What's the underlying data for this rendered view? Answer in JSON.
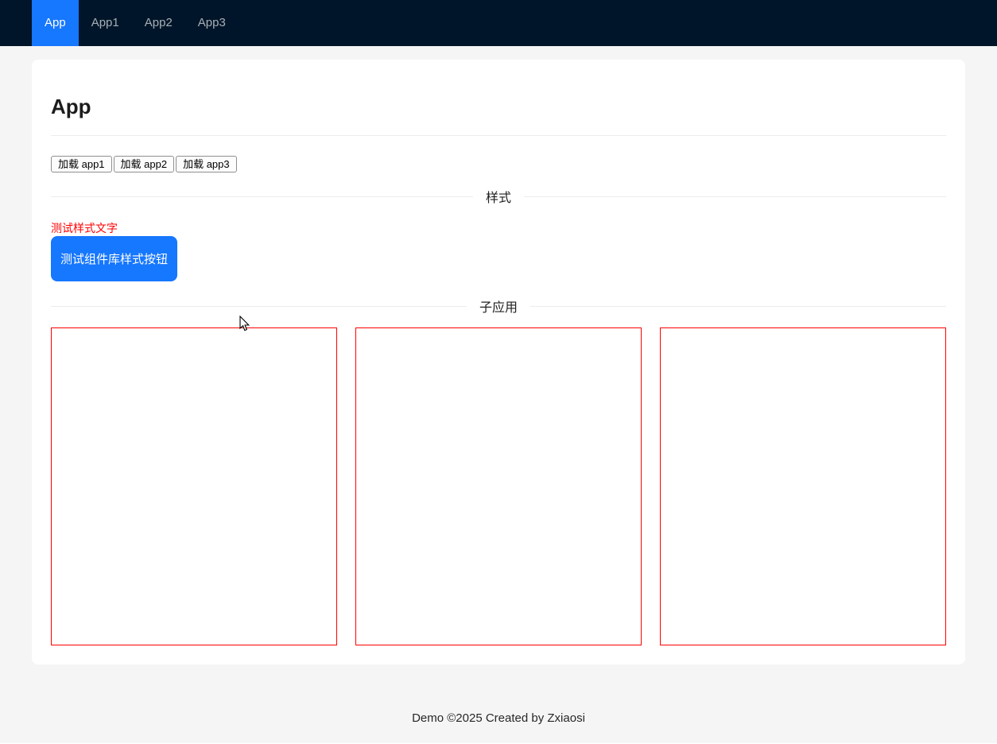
{
  "nav": {
    "items": [
      {
        "label": "App",
        "active": true
      },
      {
        "label": "App1",
        "active": false
      },
      {
        "label": "App2",
        "active": false
      },
      {
        "label": "App3",
        "active": false
      }
    ]
  },
  "main": {
    "title": "App",
    "loader_buttons": [
      {
        "label": "加载 app1"
      },
      {
        "label": "加载 app2"
      },
      {
        "label": "加载 app3"
      }
    ],
    "style_section": {
      "divider_label": "样式",
      "test_text": "测试样式文字",
      "test_button_label": "测试组件库样式按钮"
    },
    "subapp_section": {
      "divider_label": "子应用",
      "container_count": 3
    }
  },
  "footer": {
    "text": "Demo ©2025 Created by Zxiaosi"
  },
  "colors": {
    "nav_background": "#001529",
    "primary": "#1677ff",
    "danger": "#ff0000",
    "page_background": "#f5f5f5"
  }
}
